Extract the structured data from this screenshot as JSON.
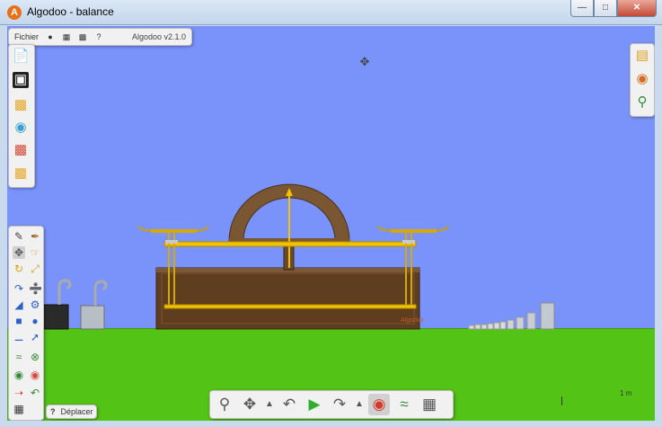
{
  "window": {
    "title": "Algodoo - balance",
    "app_icon": "algodoo-logo-icon"
  },
  "menubar": {
    "menu_label": "Fichier",
    "icons": [
      "record-icon",
      "film-icon",
      "image-icon",
      "help-icon"
    ],
    "help_label": "?",
    "version": "Algodoo v2.1.0"
  },
  "file_panel": {
    "icons": [
      "new-scene-icon",
      "save-icon",
      "open-folder-icon",
      "browse-scenes-icon",
      "phunlets-icon",
      "open-scene-icon"
    ]
  },
  "right_panel": {
    "icons": [
      "options-icon",
      "colors-icon",
      "zoom-icon"
    ]
  },
  "tools_panel": {
    "icons": [
      "sketch-tool-icon",
      "cut-tool-icon",
      "move-tool-icon",
      "drag-tool-icon",
      "rotate-tool-icon",
      "scale-tool-icon",
      "rope-tool-icon",
      "knife-tool-icon",
      "polygon-tool-icon",
      "gear-tool-icon",
      "box-tool-icon",
      "circle-tool-icon",
      "plane-tool-icon",
      "chain-tool-icon",
      "spring-tool-icon",
      "fixate-tool-icon",
      "hinge-tool-icon",
      "tracer-tool-icon",
      "laser-tool-icon",
      "thruster-tool-icon",
      "fill-tool-icon"
    ]
  },
  "status": {
    "help": "?",
    "tool_label": "Déplacer"
  },
  "bottom_bar": {
    "icons": [
      "zoom-icon",
      "pan-icon",
      "up-arrow-icon",
      "undo-icon",
      "play-icon",
      "redo-icon",
      "up-arrow-icon",
      "gravity-icon",
      "air-icon",
      "grid-icon"
    ]
  },
  "scale": {
    "label": "1 m"
  },
  "scene": {
    "brand": "Algodoo",
    "colors": {
      "sky": "#7a93fb",
      "ground": "#53c315",
      "wood": "#6a4a2b",
      "gold": "#f2c200"
    }
  }
}
